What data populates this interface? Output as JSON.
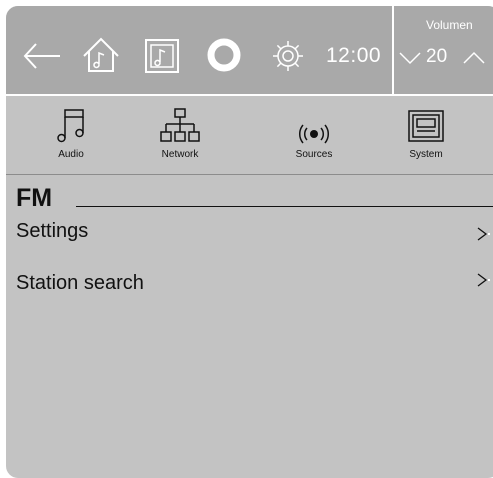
{
  "header": {
    "clock": "12:00",
    "volume_label": "Volumen",
    "volume_value": "20"
  },
  "icons": {
    "back": "back-arrow-icon",
    "home": "home-music-icon",
    "library": "music-library-icon",
    "assistant": "voice-assistant-ring-icon",
    "settings": "gear-icon",
    "volume_down": "chevron-down-icon",
    "volume_up": "chevron-up-icon"
  },
  "categories": [
    {
      "label": "Audio",
      "icon": "music-note-icon"
    },
    {
      "label": "Network",
      "icon": "network-tree-icon"
    },
    {
      "label": "Sources",
      "icon": "broadcast-icon"
    },
    {
      "label": "System",
      "icon": "device-icon"
    }
  ],
  "page": {
    "title": "FM",
    "items": [
      {
        "label": "Settings"
      },
      {
        "label": "Station search"
      }
    ]
  },
  "colors": {
    "header_bg": "#a9a9a9",
    "body_bg": "#c3c3c3",
    "foreground": "#ffffff",
    "text": "#111111"
  }
}
